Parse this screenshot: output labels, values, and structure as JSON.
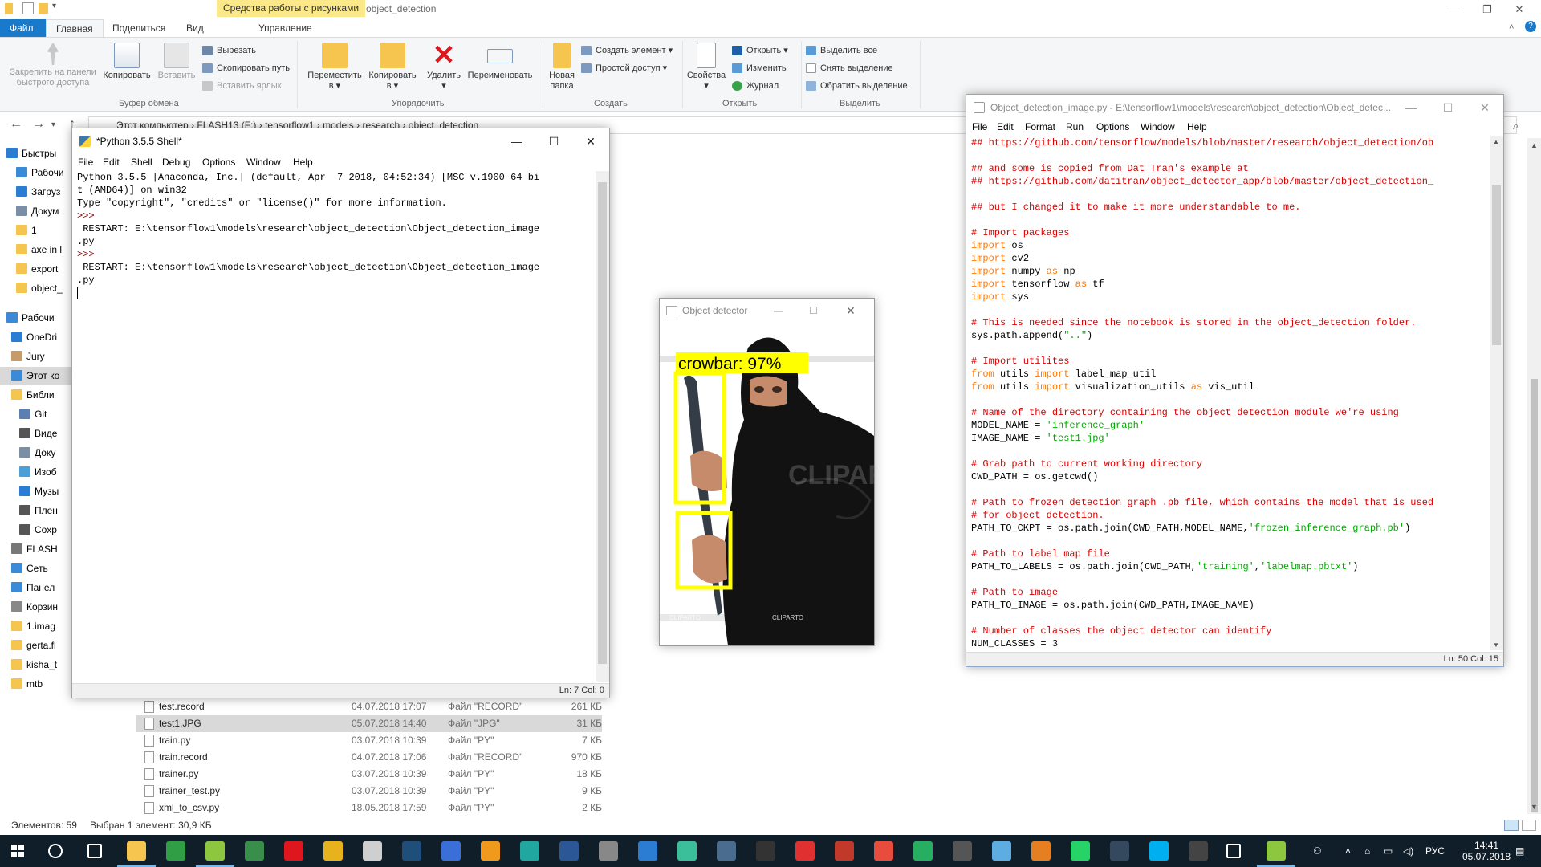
{
  "explorer": {
    "context_tab": "Средства работы с рисунками",
    "window_title": "object_detection",
    "tabs": [
      "Файл",
      "Главная",
      "Поделиться",
      "Вид",
      "Управление"
    ],
    "ribbon": {
      "pin": "Закрепить на панели быстрого доступа",
      "pin_line1": "Закрепить на панели",
      "pin_line2": "быстрого доступа",
      "copy": "Копировать",
      "paste": "Вставить",
      "cut": "Вырезать",
      "copy_path": "Скопировать путь",
      "paste_shortcut": "Вставить ярлык",
      "group_clipboard": "Буфер обмена",
      "move": "Переместить",
      "move2": "в ▾",
      "copyto": "Копировать",
      "copyto2": "в ▾",
      "delete": "Удалить",
      "delete2": "▾",
      "rename": "Переименовать",
      "group_organize": "Упорядочить",
      "new_folder": "Новая",
      "new_folder2": "папка",
      "new_item": "Создать элемент ▾",
      "easy_access": "Простой доступ ▾",
      "group_new": "Создать",
      "properties": "Свойства",
      "properties2": "▾",
      "open": "Открыть ▾",
      "edit": "Изменить",
      "history": "Журнал",
      "group_open": "Открыть",
      "select_all": "Выделить все",
      "select_none": "Снять выделение",
      "invert": "Обратить выделение",
      "group_select": "Выделить"
    },
    "breadcrumbs": "Этот компьютер  ›  FLASH13 (F:)  ›  tensorflow1  ›  models  ›  research  ›  object_detection",
    "nav": [
      {
        "label": "Быстры",
        "color": "#2b7cd3"
      },
      {
        "label": "Рабочи",
        "color": "#3b8ad8"
      },
      {
        "label": "Загруз",
        "color": "#2b7cd3"
      },
      {
        "label": "Докум",
        "color": "#7a8ea5"
      },
      {
        "label": "1",
        "color": "#f5c550"
      },
      {
        "label": "axe in l",
        "color": "#f5c550"
      },
      {
        "label": "export",
        "color": "#f5c550"
      },
      {
        "label": "object_",
        "color": "#f5c550"
      },
      {
        "label": "Рабочи",
        "color": "#3b8ad8"
      },
      {
        "label": "OneDri",
        "color": "#2b7cd3"
      },
      {
        "label": "Jury",
        "color": "#c59b6a"
      },
      {
        "label": "Этот ко",
        "color": "#3b8ad8"
      },
      {
        "label": "Библи",
        "color": "#f5c550"
      },
      {
        "label": "Git",
        "color": "#5a7fb0"
      },
      {
        "label": "Виде",
        "color": "#555"
      },
      {
        "label": "Доку",
        "color": "#7a8ea5"
      },
      {
        "label": "Изоб",
        "color": "#4aa0d8"
      },
      {
        "label": "Музы",
        "color": "#2b7cd3"
      },
      {
        "label": "Плен",
        "color": "#555"
      },
      {
        "label": "Сохр",
        "color": "#555"
      },
      {
        "label": "FLASH",
        "color": "#777"
      },
      {
        "label": "Сеть",
        "color": "#3b8ad8"
      },
      {
        "label": "Панел",
        "color": "#3b8ad8"
      },
      {
        "label": "Корзин",
        "color": "#888"
      },
      {
        "label": "1.imag",
        "color": "#f5c550"
      },
      {
        "label": "gerta.fl",
        "color": "#f5c550"
      },
      {
        "label": "kisha_t",
        "color": "#f5c550"
      },
      {
        "label": "mtb",
        "color": "#f5c550"
      }
    ],
    "files": [
      {
        "name": "test.record",
        "date": "04.07.2018 17:07",
        "type": "Файл \"RECORD\"",
        "size": "261 КБ"
      },
      {
        "name": "test1.JPG",
        "date": "05.07.2018 14:40",
        "type": "Файл \"JPG\"",
        "size": "31 КБ"
      },
      {
        "name": "train.py",
        "date": "03.07.2018 10:39",
        "type": "Файл \"PY\"",
        "size": "7 КБ"
      },
      {
        "name": "train.record",
        "date": "04.07.2018 17:06",
        "type": "Файл \"RECORD\"",
        "size": "970 КБ"
      },
      {
        "name": "trainer.py",
        "date": "03.07.2018 10:39",
        "type": "Файл \"PY\"",
        "size": "18 КБ"
      },
      {
        "name": "trainer_test.py",
        "date": "03.07.2018 10:39",
        "type": "Файл \"PY\"",
        "size": "9 КБ"
      },
      {
        "name": "xml_to_csv.py",
        "date": "18.05.2018 17:59",
        "type": "Файл \"PY\"",
        "size": "2 КБ"
      }
    ],
    "status_count": "Элементов: 59",
    "status_selected": "Выбран 1 элемент: 30,9 КБ"
  },
  "shell": {
    "title": "*Python 3.5.5 Shell*",
    "menu": [
      "File",
      "Edit",
      "Shell",
      "Debug",
      "Options",
      "Window",
      "Help"
    ],
    "text": "Python 3.5.5 |Anaconda, Inc.| (default, Apr  7 2018, 04:52:34) [MSC v.1900 64 bi\nt (AMD64)] on win32\nType \"copyright\", \"credits\" or \"license()\" for more information.",
    "prompt1": ">>> ",
    "restart1": " RESTART: E:\\tensorflow1\\models\\research\\object_detection\\Object_detection_image\n.py ",
    "prompt2": ">>> ",
    "restart2": " RESTART: E:\\tensorflow1\\models\\research\\object_detection\\Object_detection_image\n.py ",
    "status": "Ln: 7   Col: 0"
  },
  "detector": {
    "title": "Object detector",
    "label": "crowbar: 97%",
    "watermark": "CLIPARTO",
    "watermark_small": "CLIPARTO"
  },
  "editor": {
    "title": "Object_detection_image.py - E:\\tensorflow1\\models\\research\\object_detection\\Object_detec...",
    "menu": [
      "File",
      "Edit",
      "Format",
      "Run",
      "Options",
      "Window",
      "Help"
    ],
    "status": "Ln: 50   Col: 15",
    "lines": [
      [
        {
          "t": "## https://github.com/tensorflow/models/blob/master/research/object_detection/ob",
          "c": "com"
        }
      ],
      [],
      [
        {
          "t": "## and some is copied from Dat Tran's example at",
          "c": "com"
        }
      ],
      [
        {
          "t": "## https://github.com/datitran/object_detector_app/blob/master/object_detection_",
          "c": "com"
        }
      ],
      [],
      [
        {
          "t": "## but I changed it to make it more understandable to me.",
          "c": "com"
        }
      ],
      [],
      [
        {
          "t": "# Import packages",
          "c": "com"
        }
      ],
      [
        {
          "t": "import",
          "c": "kw"
        },
        {
          "t": " os",
          "c": ""
        }
      ],
      [
        {
          "t": "import",
          "c": "kw"
        },
        {
          "t": " cv2",
          "c": ""
        }
      ],
      [
        {
          "t": "import",
          "c": "kw"
        },
        {
          "t": " numpy ",
          "c": ""
        },
        {
          "t": "as",
          "c": "kw"
        },
        {
          "t": " np",
          "c": ""
        }
      ],
      [
        {
          "t": "import",
          "c": "kw"
        },
        {
          "t": " tensorflow ",
          "c": ""
        },
        {
          "t": "as",
          "c": "kw"
        },
        {
          "t": " tf",
          "c": ""
        }
      ],
      [
        {
          "t": "import",
          "c": "kw"
        },
        {
          "t": " sys",
          "c": ""
        }
      ],
      [],
      [
        {
          "t": "# This is needed since the notebook is stored in the object_detection folder.",
          "c": "com"
        }
      ],
      [
        {
          "t": "sys.path.append(",
          "c": ""
        },
        {
          "t": "\"..\"",
          "c": "str"
        },
        {
          "t": ")",
          "c": ""
        }
      ],
      [],
      [
        {
          "t": "# Import utilites",
          "c": "com"
        }
      ],
      [
        {
          "t": "from",
          "c": "kw"
        },
        {
          "t": " utils ",
          "c": ""
        },
        {
          "t": "import",
          "c": "kw"
        },
        {
          "t": " label_map_util",
          "c": ""
        }
      ],
      [
        {
          "t": "from",
          "c": "kw"
        },
        {
          "t": " utils ",
          "c": ""
        },
        {
          "t": "import",
          "c": "kw"
        },
        {
          "t": " visualization_utils ",
          "c": ""
        },
        {
          "t": "as",
          "c": "kw"
        },
        {
          "t": " vis_util",
          "c": ""
        }
      ],
      [],
      [
        {
          "t": "# Name of the directory containing the object detection module we're using",
          "c": "com"
        }
      ],
      [
        {
          "t": "MODEL_NAME = ",
          "c": ""
        },
        {
          "t": "'inference_graph'",
          "c": "str"
        }
      ],
      [
        {
          "t": "IMAGE_NAME = ",
          "c": ""
        },
        {
          "t": "'test1.jpg'",
          "c": "str"
        }
      ],
      [],
      [
        {
          "t": "# Grab path to current working directory",
          "c": "com"
        }
      ],
      [
        {
          "t": "CWD_PATH = os.getcwd()",
          "c": ""
        }
      ],
      [],
      [
        {
          "t": "# Path to frozen detection graph .pb file, which contains the model that is used",
          "c": "com"
        }
      ],
      [
        {
          "t": "# for object detection.",
          "c": "com"
        }
      ],
      [
        {
          "t": "PATH_TO_CKPT = os.path.join(CWD_PATH,MODEL_NAME,",
          "c": ""
        },
        {
          "t": "'frozen_inference_graph.pb'",
          "c": "str"
        },
        {
          "t": ")",
          "c": ""
        }
      ],
      [],
      [
        {
          "t": "# Path to label map file",
          "c": "com"
        }
      ],
      [
        {
          "t": "PATH_TO_LABELS = os.path.join(CWD_PATH,",
          "c": ""
        },
        {
          "t": "'training'",
          "c": "str"
        },
        {
          "t": ",",
          "c": ""
        },
        {
          "t": "'labelmap.pbtxt'",
          "c": "str"
        },
        {
          "t": ")",
          "c": ""
        }
      ],
      [],
      [
        {
          "t": "# Path to image",
          "c": "com"
        }
      ],
      [
        {
          "t": "PATH_TO_IMAGE = os.path.join(CWD_PATH,IMAGE_NAME)",
          "c": ""
        }
      ],
      [],
      [
        {
          "t": "# Number of classes the object detector can identify",
          "c": "com"
        }
      ],
      [
        {
          "t": "NUM_CLASSES = 3",
          "c": ""
        }
      ]
    ]
  },
  "taskbar": {
    "time": "14:41",
    "date": "05.07.2018",
    "lang": "РУС",
    "apps": [
      {
        "name": "search-icon",
        "color": "#ffffff"
      },
      {
        "name": "task-view-icon",
        "color": "#ffffff"
      },
      {
        "name": "explorer-icon",
        "color": "#f5c550"
      },
      {
        "name": "xbox-icon",
        "color": "#2f9e44"
      },
      {
        "name": "idle-icon",
        "color": "#8dc63f"
      },
      {
        "name": "sheets-icon",
        "color": "#3a8e4c"
      },
      {
        "name": "opera-icon",
        "color": "#e0161e"
      },
      {
        "name": "chrome-icon",
        "color": "#e8b21c"
      },
      {
        "name": "camera-icon",
        "color": "#cfcfcf"
      },
      {
        "name": "photoshop-icon",
        "color": "#1f4e7a"
      },
      {
        "name": "teams-icon",
        "color": "#3a6fd8"
      },
      {
        "name": "sublime-icon",
        "color": "#f09a1d"
      },
      {
        "name": "app3-icon",
        "color": "#1fa7a0"
      },
      {
        "name": "powershell-icon",
        "color": "#2b5797"
      },
      {
        "name": "globe-icon",
        "color": "#888"
      },
      {
        "name": "network-app-icon",
        "color": "#2b7cd3"
      },
      {
        "name": "m-app-icon",
        "color": "#3bbf9a"
      },
      {
        "name": "steam-icon",
        "color": "#4a6d8f"
      },
      {
        "name": "epic-icon",
        "color": "#333"
      },
      {
        "name": "media-icon",
        "color": "#e03030"
      },
      {
        "name": "app-red-icon",
        "color": "#c0392b"
      },
      {
        "name": "app-red2-icon",
        "color": "#e74c3c"
      },
      {
        "name": "green-app-icon",
        "color": "#27ae60"
      },
      {
        "name": "app-box-icon",
        "color": "#555"
      },
      {
        "name": "app-blue-icon",
        "color": "#5dade2"
      },
      {
        "name": "app-orange-icon",
        "color": "#e67e22"
      },
      {
        "name": "whatsapp-icon",
        "color": "#25d366"
      },
      {
        "name": "app-purple-icon",
        "color": "#34495e"
      },
      {
        "name": "skype-icon",
        "color": "#00aff0"
      },
      {
        "name": "terminal-icon",
        "color": "#444"
      },
      {
        "name": "settings-icon",
        "color": "#ffffff"
      },
      {
        "name": "idle-doc-icon",
        "color": "#8dc63f"
      }
    ]
  }
}
